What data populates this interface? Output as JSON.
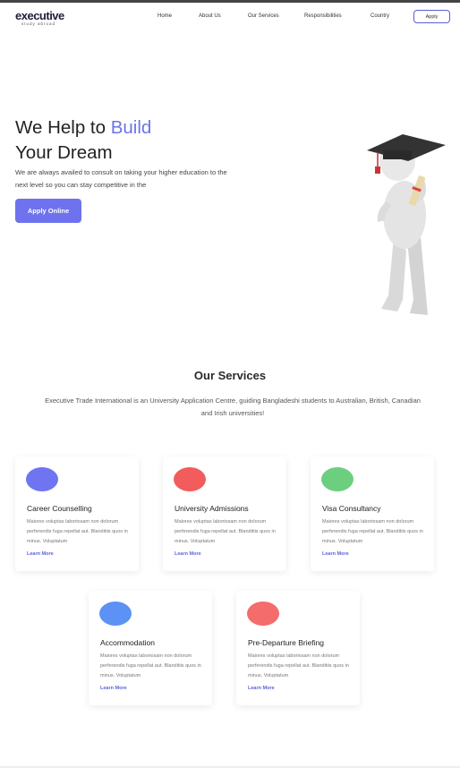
{
  "brand": {
    "name": "executive",
    "tagline": "study abroad"
  },
  "nav": {
    "links": [
      "Home",
      "About Us",
      "Our Services",
      "Responsibilities",
      "Country"
    ],
    "apply_label": "Apply"
  },
  "hero": {
    "title_part1": "We Help to ",
    "title_highlight": "Build",
    "title_line2": "Your Dream",
    "description": "We are always availed to consult on taking your higher education to the next level so you can stay competitive in the",
    "button_label": "Apply Online",
    "accent_color": "#6b75e8"
  },
  "services": {
    "title": "Our Services",
    "description": "Executive Trade International is an University Application Centre, guiding Bangladeshi students to Australian, British, Canadian and Irish universities!",
    "cards": [
      {
        "title": "Career Counselling",
        "color": "#6f74f3",
        "text": "Maiores voluptas laboriosam non dolorum perferendis fuga repellat aut. Blanditiis quos in minus. Voluptatum",
        "link": "Learn More"
      },
      {
        "title": "University Admissions",
        "color": "#f25c5c",
        "text": "Maiores voluptas laboriosam non dolorum perferendis fuga repellat aut. Blanditiis quos in minus. Voluptatum",
        "link": "Learn More"
      },
      {
        "title": "Visa Consultancy",
        "color": "#6ccf7f",
        "text": "Maiores voluptas laboriosam non dolorum perferendis fuga repellat aut. Blanditiis quos in minus. Voluptatum",
        "link": "Learn More"
      },
      {
        "title": "Accommodation",
        "color": "#5c92f5",
        "text": "Maiores voluptas laboriosam non dolorum perferendis fuga repellat aut. Blanditiis quos in minus. Voluptatum",
        "link": "Learn More"
      },
      {
        "title": "Pre-Departure Briefing",
        "color": "#f56c6c",
        "text": "Maiores voluptas laboriosam non dolorum perferendis fuga repellat aut. Blanditiis quos in minus. Voluptatum",
        "link": "Learn More"
      }
    ]
  }
}
